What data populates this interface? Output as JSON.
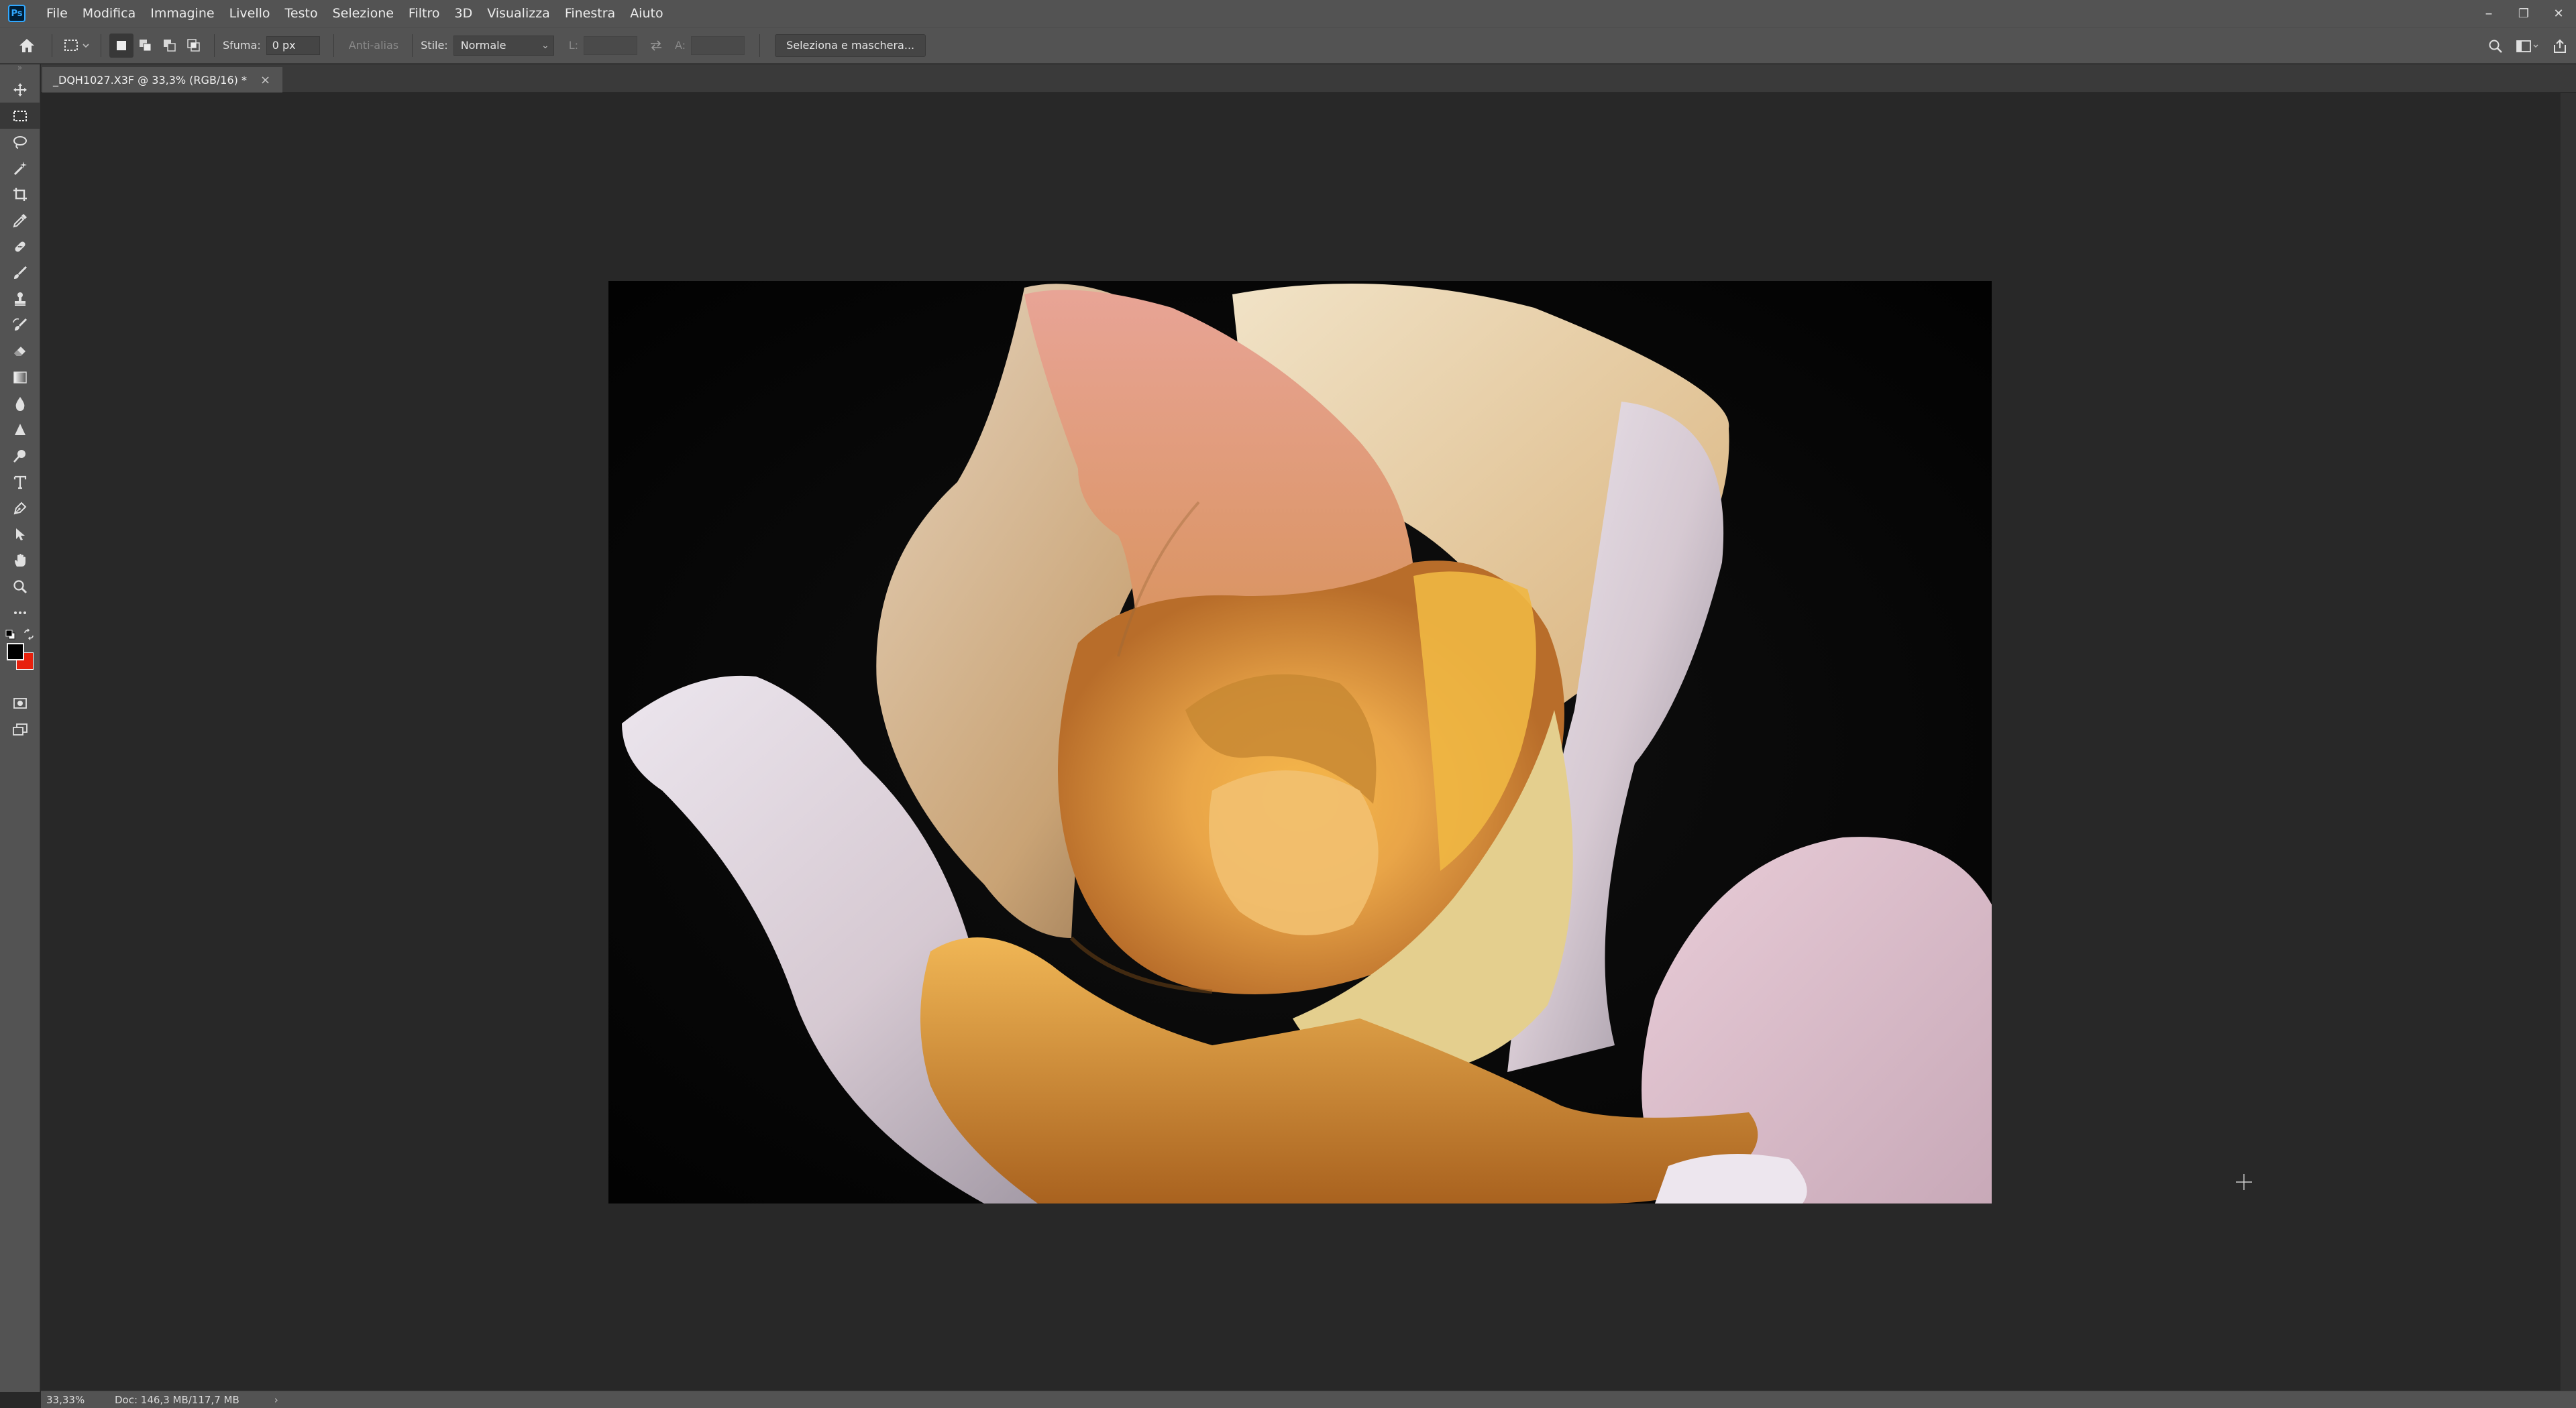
{
  "app": {
    "logo_text": "Ps"
  },
  "menu": [
    "File",
    "Modifica",
    "Immagine",
    "Livello",
    "Testo",
    "Selezione",
    "Filtro",
    "3D",
    "Visualizza",
    "Finestra",
    "Aiuto"
  ],
  "window_controls": {
    "minimize": "–",
    "restore": "❐",
    "close": "✕"
  },
  "options": {
    "feather_label": "Sfuma:",
    "feather_value": "0 px",
    "antialias_label": "Anti-alias",
    "style_label": "Stile:",
    "style_value": "Normale",
    "width_label": "L:",
    "height_label": "A:",
    "select_mask_button": "Seleziona e maschera..."
  },
  "document": {
    "tab_title": "_DQH1027.X3F @ 33,3% (RGB/16) *",
    "close": "×"
  },
  "status": {
    "zoom": "33,33%",
    "doc_size": "Doc: 146,3 MB/117,7 MB",
    "arrow": "›"
  },
  "tools": [
    "move-icon",
    "marquee-icon",
    "lasso-icon",
    "magic-wand-icon",
    "crop-icon",
    "eyedropper-icon",
    "spot-healing-icon",
    "brush-icon",
    "clone-stamp-icon",
    "history-brush-icon",
    "eraser-icon",
    "gradient-icon",
    "blur-icon",
    "dodge-icon",
    "pen-icon",
    "type-icon",
    "path-selection-icon",
    "shape-icon",
    "hand-icon",
    "zoom-icon",
    "more-icon"
  ],
  "colors": {
    "foreground": "#000000",
    "background": "#e8200c",
    "accent": "#31a8ff"
  }
}
